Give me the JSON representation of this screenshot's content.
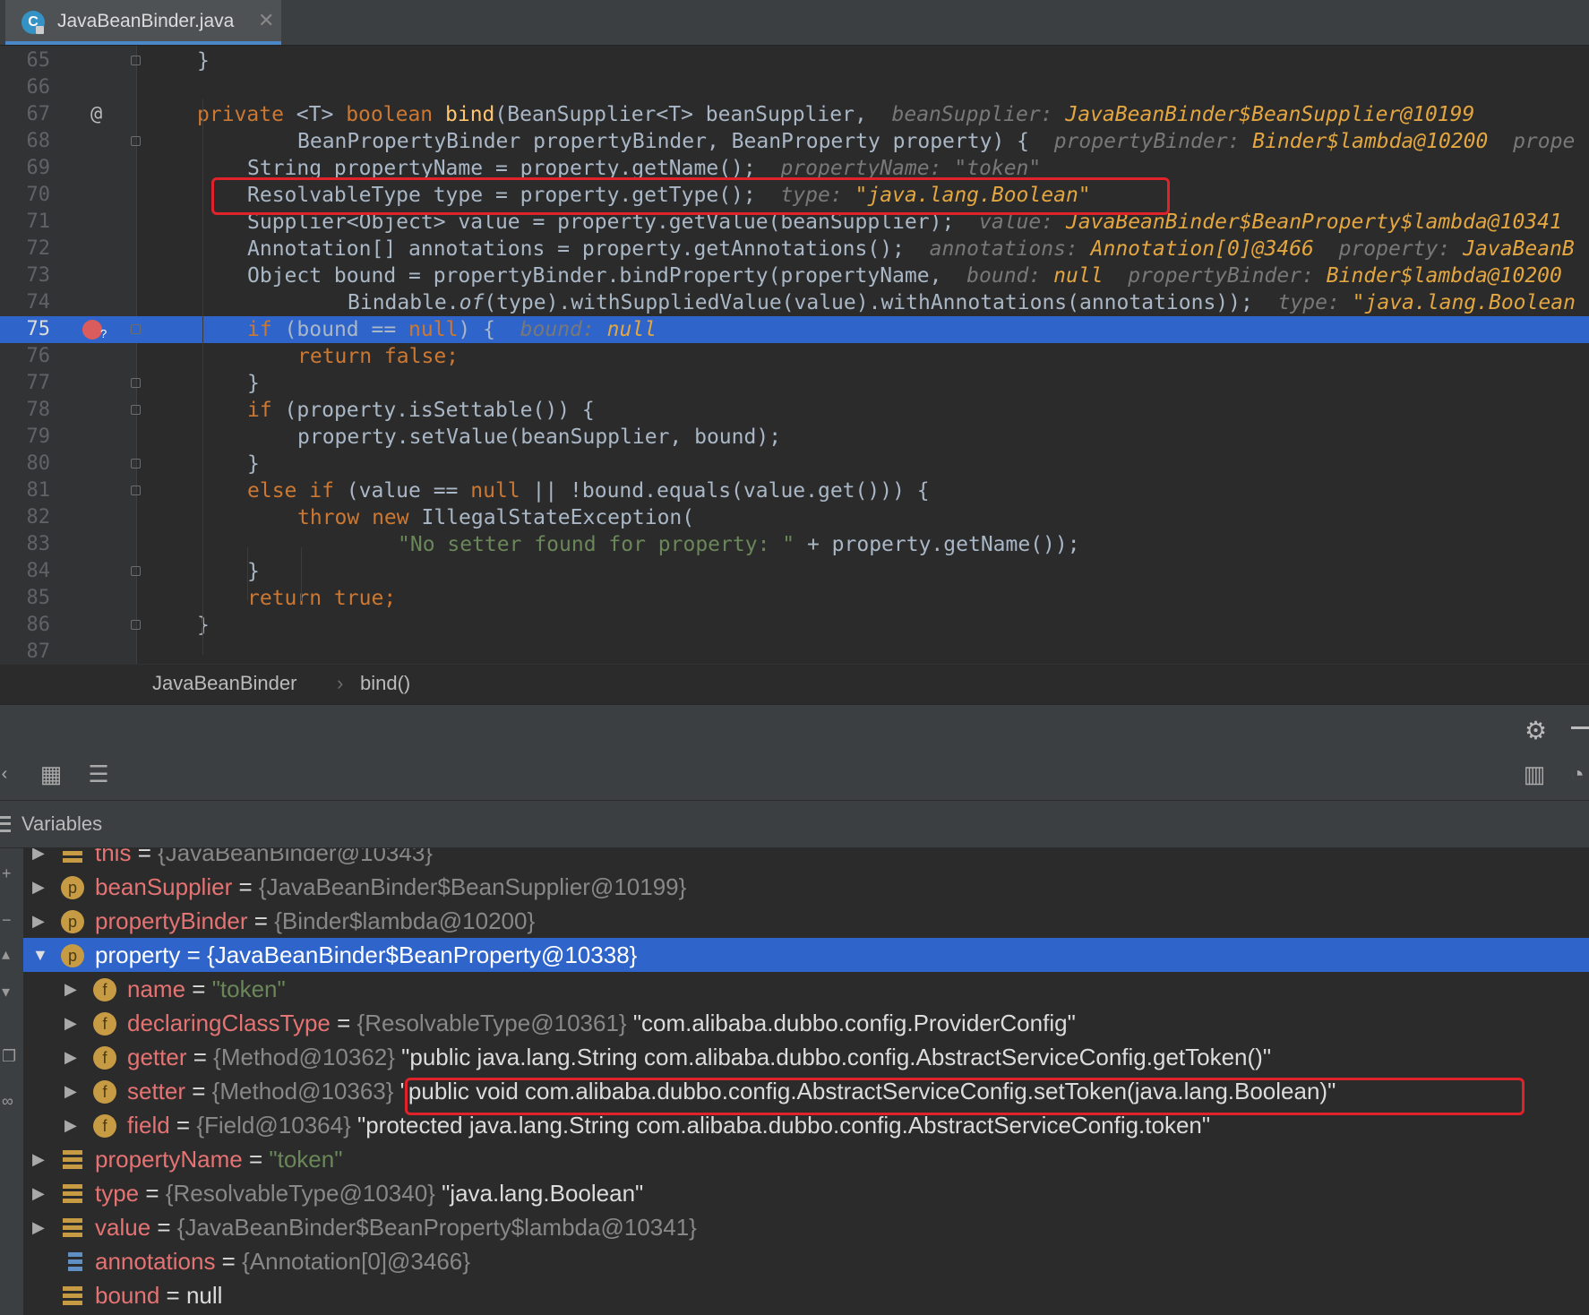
{
  "tab": {
    "title": "JavaBeanBinder.java",
    "icon_letter": "C",
    "close": "✕"
  },
  "editor": {
    "lines": [
      {
        "num": "65"
      },
      {
        "num": "66"
      },
      {
        "num": "67",
        "gutter": "@"
      },
      {
        "num": "68"
      },
      {
        "num": "69"
      },
      {
        "num": "70"
      },
      {
        "num": "71"
      },
      {
        "num": "72"
      },
      {
        "num": "73"
      },
      {
        "num": "74"
      },
      {
        "num": "75",
        "current": true
      },
      {
        "num": "76"
      },
      {
        "num": "77"
      },
      {
        "num": "78"
      },
      {
        "num": "79"
      },
      {
        "num": "80"
      },
      {
        "num": "81"
      },
      {
        "num": "82"
      },
      {
        "num": "83"
      },
      {
        "num": "84"
      },
      {
        "num": "85"
      },
      {
        "num": "86"
      },
      {
        "num": "87"
      }
    ],
    "code": {
      "l65": "}",
      "l67_kw1": "private",
      "l67_t": "<T>",
      "l67_kw2": "boolean",
      "l67_fn": "bind",
      "l67_rest": "(BeanSupplier<T> beanSupplier,",
      "l67_h": "beanSupplier:",
      "l67_v": "JavaBeanBinder$BeanSupplier@10199",
      "l68_code": "BeanPropertyBinder propertyBinder, BeanProperty property) {",
      "l68_h": "propertyBinder:",
      "l68_v": "Binder$lambda@10200",
      "l68_h2": "prope",
      "l69_code": "String propertyName = property.getName();",
      "l69_h": "propertyName:",
      "l69_v": "\"token\"",
      "l70_code": "ResolvableType type = property.getType();",
      "l70_h": "type:",
      "l70_v": "\"java.lang.Boolean\"",
      "l71_code": "Supplier<Object> value = property.getValue(beanSupplier);",
      "l71_h": "value:",
      "l71_v": "JavaBeanBinder$BeanProperty$lambda@10341",
      "l72_code": "Annotation[] annotations = property.getAnnotations();",
      "l72_h": "annotations:",
      "l72_v": "Annotation[0]@3466",
      "l72_h2": "property:",
      "l72_v2": "JavaBeanB",
      "l73_code": "Object bound = propertyBinder.bindProperty(propertyName,",
      "l73_h": "bound:",
      "l73_v": "null",
      "l73_h2": "propertyBinder:",
      "l73_v2": "Binder$lambda@10200",
      "l74_a": "Bindable.",
      "l74_of": "of",
      "l74_b": "(type).withSuppliedValue(value).withAnnotations(annotations));",
      "l74_h": "type:",
      "l74_v": "\"java.lang.Boolean",
      "l75_kw": "if",
      "l75_a": " (bound == ",
      "l75_null": "null",
      "l75_b": ") {",
      "l75_h": "bound:",
      "l75_v": "null",
      "l76_kw": "return false;",
      "l77": "}",
      "l78_kw": "if",
      "l78_rest": " (property.isSettable()) {",
      "l79": "property.setValue(beanSupplier, bound);",
      "l80": "}",
      "l81_kw1": "else if",
      "l81_a": " (value == ",
      "l81_null": "null",
      "l81_b": " || !bound.equals(value.get())) {",
      "l82_kw": "throw new",
      "l82_rest": " IllegalStateException(",
      "l83_str": "\"No setter found for property: \"",
      "l83_rest": " + property.getName());",
      "l84": "}",
      "l85_kw": "return true;",
      "l86": "}"
    }
  },
  "breadcrumb": {
    "class": "JavaBeanBinder",
    "sep": "›",
    "method": "bind()"
  },
  "panel": {
    "section_title": "Variables"
  },
  "variables": [
    {
      "name": "this",
      "eq": " = ",
      "type": "{JavaBeanBinder@10343}",
      "value": "",
      "icon": "stack",
      "indent": 0,
      "arrow": "▶"
    },
    {
      "name": "beanSupplier",
      "eq": " = ",
      "type": "{JavaBeanBinder$BeanSupplier@10199}",
      "value": "",
      "icon": "p",
      "indent": 0,
      "arrow": "▶"
    },
    {
      "name": "propertyBinder",
      "eq": " = ",
      "type": "{Binder$lambda@10200}",
      "value": "",
      "icon": "p",
      "indent": 0,
      "arrow": "▶"
    },
    {
      "name": "property",
      "eq": " = ",
      "type": "{JavaBeanBinder$BeanProperty@10338}",
      "value": "",
      "icon": "p",
      "indent": 0,
      "arrow": "▼",
      "selected": true
    },
    {
      "name": "name",
      "eq": " = ",
      "type": "",
      "value": "\"token\"",
      "valueClass": "vstr",
      "icon": "f",
      "indent": 1,
      "arrow": "▶"
    },
    {
      "name": "declaringClassType",
      "eq": " = ",
      "type": "{ResolvableType@10361}",
      "value": " \"com.alibaba.dubbo.config.ProviderConfig\"",
      "icon": "f",
      "indent": 1,
      "arrow": "▶"
    },
    {
      "name": "getter",
      "eq": " = ",
      "type": "{Method@10362}",
      "value": " \"public java.lang.String com.alibaba.dubbo.config.AbstractServiceConfig.getToken()\"",
      "icon": "f",
      "indent": 1,
      "arrow": "▶"
    },
    {
      "name": "setter",
      "eq": " = ",
      "type": "{Method@10363}",
      "value": " \"public void com.alibaba.dubbo.config.AbstractServiceConfig.setToken(java.lang.Boolean)\"",
      "icon": "f",
      "indent": 1,
      "arrow": "▶"
    },
    {
      "name": "field",
      "eq": " = ",
      "type": "{Field@10364}",
      "value": " \"protected java.lang.String com.alibaba.dubbo.config.AbstractServiceConfig.token\"",
      "icon": "f",
      "indent": 1,
      "arrow": "▶"
    },
    {
      "name": "propertyName",
      "eq": " = ",
      "type": "",
      "value": "\"token\"",
      "valueClass": "vstr",
      "icon": "stack",
      "indent": 0,
      "arrow": "▶"
    },
    {
      "name": "type",
      "eq": " = ",
      "type": "{ResolvableType@10340}",
      "value": " \"java.lang.Boolean\"",
      "icon": "stack",
      "indent": 0,
      "arrow": "▶"
    },
    {
      "name": "value",
      "eq": " = ",
      "type": "{JavaBeanBinder$BeanProperty$lambda@10341}",
      "value": "",
      "icon": "stack",
      "indent": 0,
      "arrow": "▶"
    },
    {
      "name": "annotations",
      "eq": " = ",
      "type": "{Annotation[0]@3466}",
      "value": "",
      "icon": "arr",
      "indent": 0,
      "arrow": ""
    },
    {
      "name": "bound",
      "eq": " = ",
      "type": "",
      "value": "null",
      "icon": "stack",
      "indent": 0,
      "arrow": ""
    }
  ]
}
